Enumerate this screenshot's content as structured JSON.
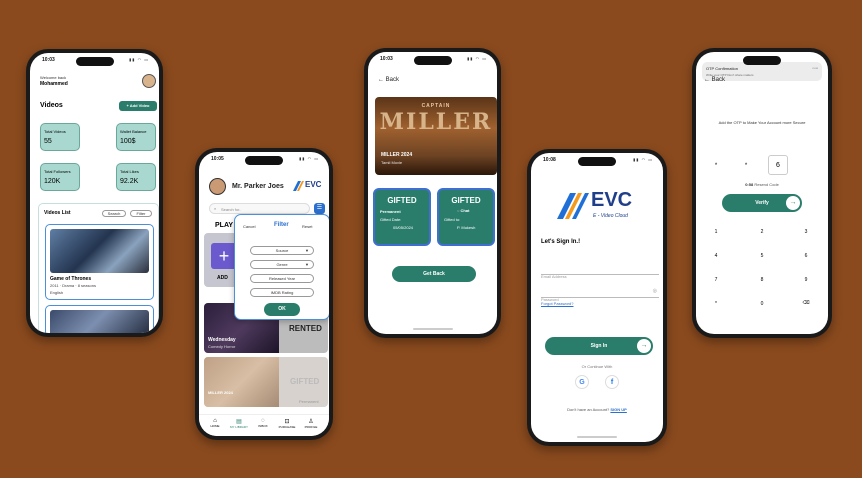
{
  "phone1": {
    "time": "10:03",
    "welcome": "Welcome back",
    "user": "Mohammed",
    "title": "Videos",
    "add_video": "+ Add Video",
    "stats": [
      {
        "label": "Total Videos",
        "value": "55"
      },
      {
        "label": "Wallet Balance",
        "value": "100$"
      },
      {
        "label": "Total Followers",
        "value": "120K"
      },
      {
        "label": "Total Likes",
        "value": "92.2K"
      }
    ],
    "videos_list": "Videos List",
    "search": "Search",
    "filter": "Filter",
    "video1": {
      "title": "Game of Thrones",
      "meta": "2011 · Drama · 8 seasons",
      "lang": "English"
    }
  },
  "phone2": {
    "time": "10:05",
    "name": "Mr. Parker Joes",
    "brand": "EVC",
    "search_placeholder": "Search for..",
    "section": "PLAY",
    "add_label": "ADD",
    "filter_cancel": "Cancel",
    "filter_title": "Filter",
    "filter_reset": "Reset",
    "filter_options": [
      "Source",
      "Genre",
      "Released Year",
      "IMDB Rating"
    ],
    "ok": "OK",
    "rented": "RENTED",
    "movie1": "Wednesday",
    "movie1_sub": "Comedy Horror",
    "gifted": "GIFTED",
    "permanent": "Permanent",
    "movie2": "MILLER 2024",
    "nav": [
      "HOME",
      "MY LIBRARY",
      "INBOX",
      "PURCHASE",
      "PROFILE"
    ]
  },
  "phone3": {
    "time": "10:03",
    "back": "Back",
    "poster_top": "CAPTAIN",
    "poster_big": "MILLER",
    "poster_title": "MILLER 2024",
    "poster_sub": "Tamil Movie",
    "card1": {
      "title": "GIFTED",
      "type": "Permanent",
      "label": "Gifted Date:",
      "value": "05/05/2024"
    },
    "card2": {
      "title": "GIFTED",
      "chat": "Chat",
      "label": "Gifted to:",
      "value": "P. Mukesh"
    },
    "get_back": "Get Back"
  },
  "phone4": {
    "time": "10:08",
    "brand": "EVC",
    "brand_sub": "E - Video Cloud",
    "heading": "Let's Sign In.!",
    "email_placeholder": "Email Address",
    "password_placeholder": "Password",
    "forgot": "Forgot Password?",
    "sign_in": "Sign In",
    "or_continue": "Or Continue With",
    "no_account": "Don't have an Account?",
    "sign_up": "SIGN UP"
  },
  "phone5": {
    "notif_title": "OTP Confirmation",
    "notif_body": "Write your OTP Don't share matters",
    "notif_time": "now",
    "back": "Back",
    "instruction": "Add the OTP to Make Your Account more Secure",
    "otp": [
      "*",
      "*",
      "6",
      ""
    ],
    "timer": "0:58",
    "resend": "Resend Code",
    "verify": "Verify",
    "keys": [
      "1",
      "2",
      "3",
      "4",
      "5",
      "6",
      "7",
      "8",
      "9",
      "*",
      "0",
      "⌫"
    ]
  }
}
